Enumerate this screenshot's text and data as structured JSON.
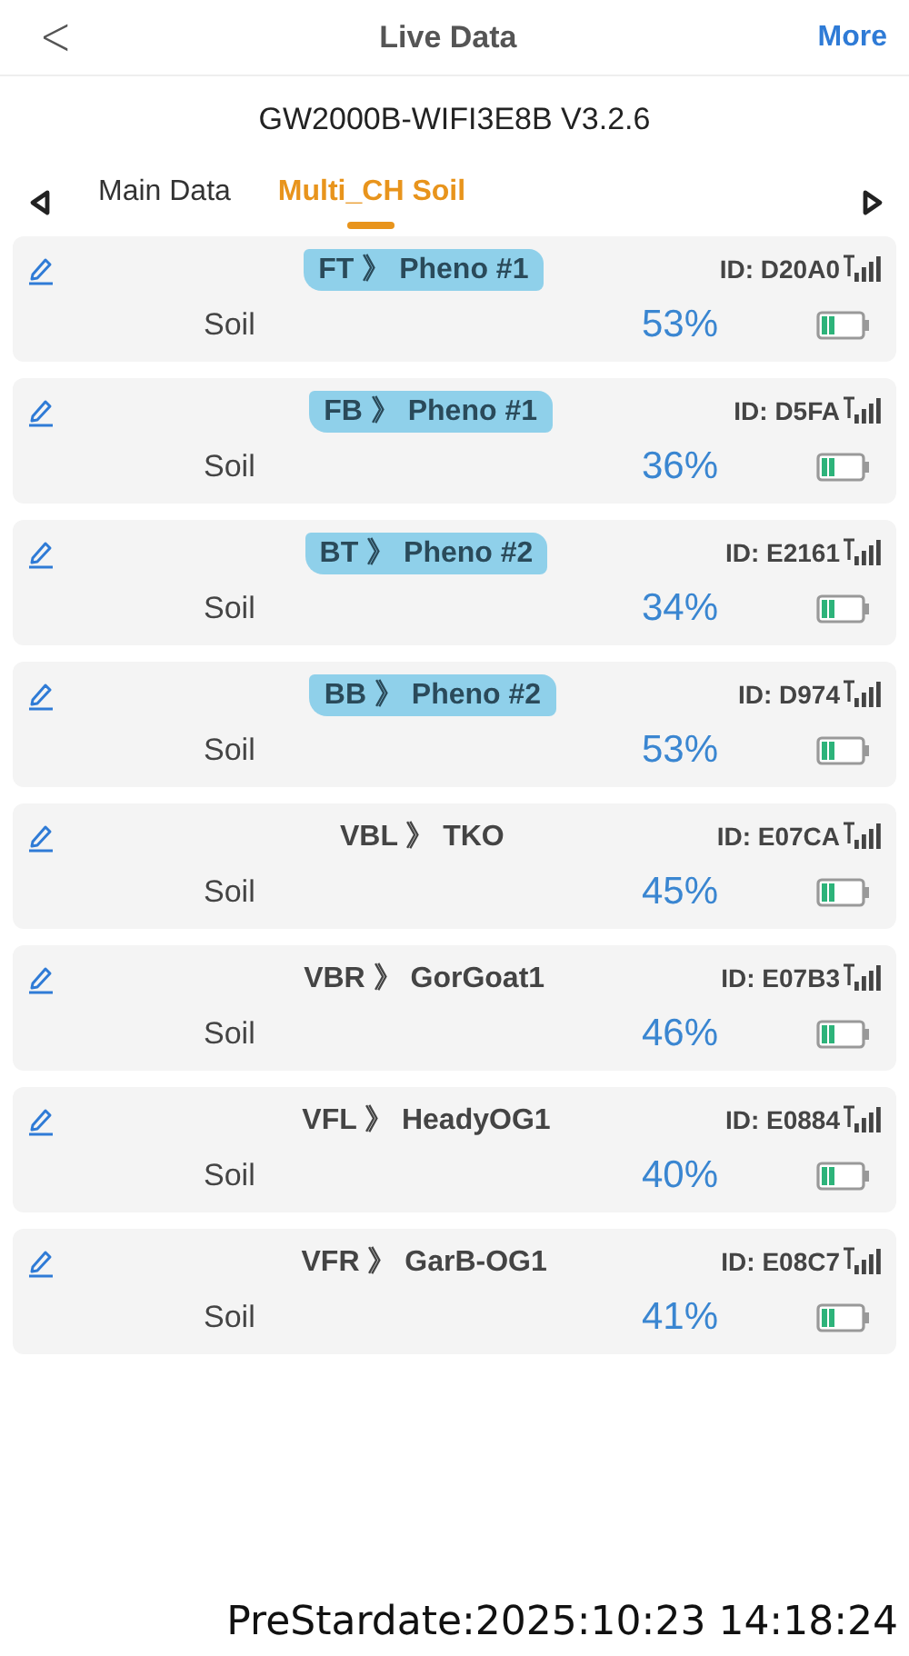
{
  "header": {
    "back": "<",
    "title": "Live Data",
    "action": "More"
  },
  "device": "GW2000B-WIFI3E8B V3.2.6",
  "tabs": [
    {
      "label": "Main Data",
      "selected": false
    },
    {
      "label": "Multi_CH Soil",
      "selected": true
    }
  ],
  "sensors": [
    {
      "name": "FT 》 Pheno #1",
      "highlighted": true,
      "id": "ID: D20A0",
      "label": "Soil",
      "value": "53%"
    },
    {
      "name": "FB 》 Pheno #1",
      "highlighted": true,
      "id": "ID: D5FA",
      "label": "Soil",
      "value": "36%"
    },
    {
      "name": "BT 》 Pheno #2",
      "highlighted": true,
      "id": "ID: E2161",
      "label": "Soil",
      "value": "34%"
    },
    {
      "name": "BB 》 Pheno #2",
      "highlighted": true,
      "id": "ID: D974",
      "label": "Soil",
      "value": "53%"
    },
    {
      "name": "VBL 》 TKO",
      "highlighted": false,
      "id": "ID: E07CA",
      "label": "Soil",
      "value": "45%"
    },
    {
      "name": "VBR 》 GorGoat1",
      "highlighted": false,
      "id": "ID: E07B3",
      "label": "Soil",
      "value": "46%"
    },
    {
      "name": "VFL 》 HeadyOG1",
      "highlighted": false,
      "id": "ID: E0884",
      "label": "Soil",
      "value": "40%"
    },
    {
      "name": "VFR 》 GarB-OG1",
      "highlighted": false,
      "id": "ID: E08C7",
      "label": "Soil",
      "value": "41%"
    }
  ],
  "timestamp": "PreStardate:2025:10:23 14:18:24"
}
